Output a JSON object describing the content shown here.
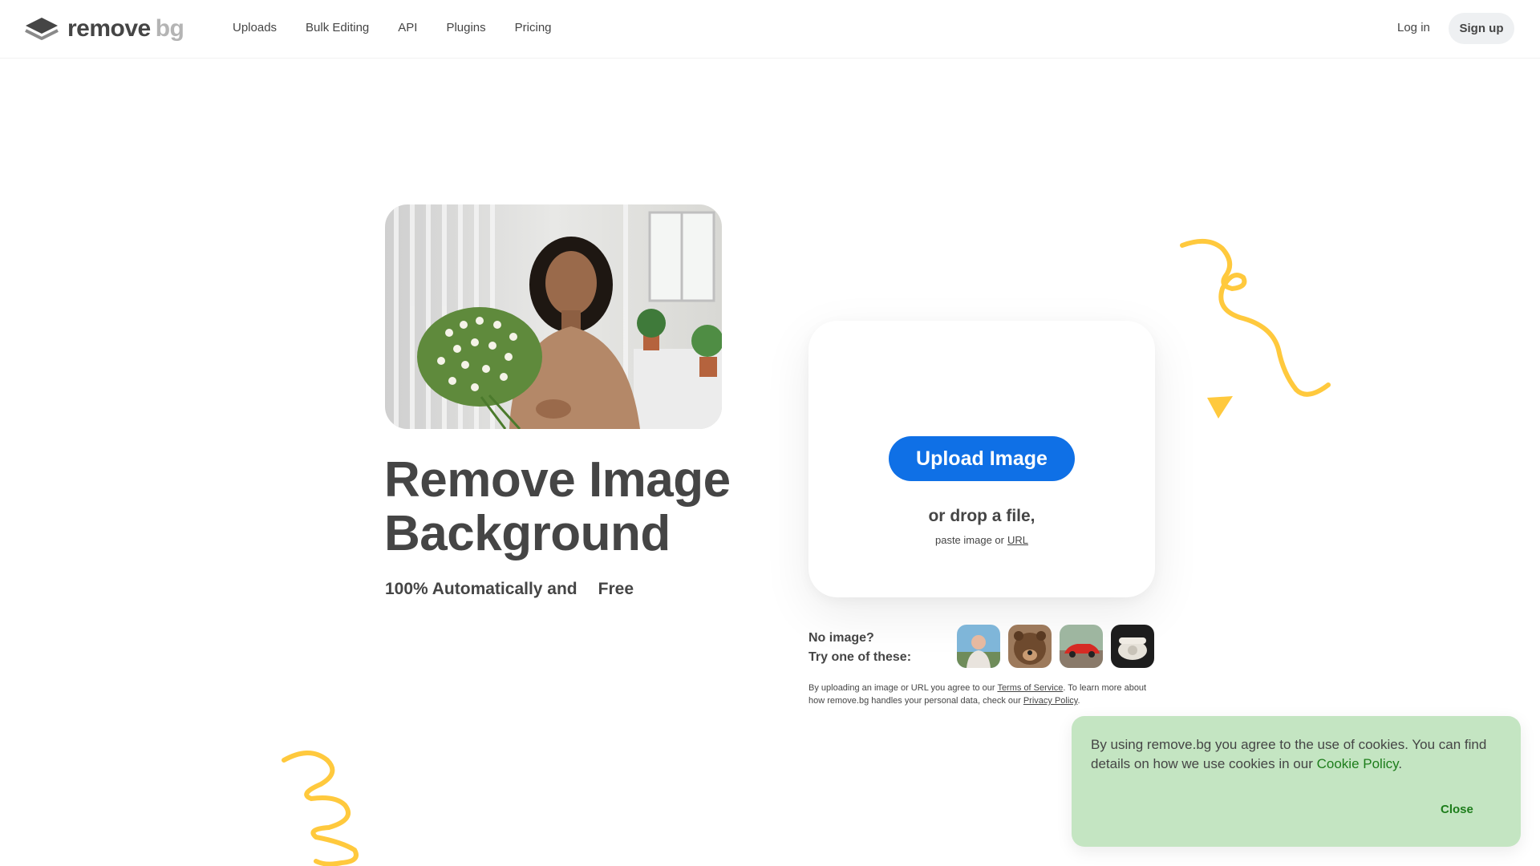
{
  "header": {
    "logo": {
      "word1": "remove",
      "word2": "bg"
    },
    "nav": [
      "Uploads",
      "Bulk Editing",
      "API",
      "Plugins",
      "Pricing"
    ],
    "login": "Log in",
    "signup": "Sign up"
  },
  "hero": {
    "title_line1": "Remove Image",
    "title_line2": "Background",
    "subtitle": "100% Automatically and",
    "free": "Free"
  },
  "upload": {
    "button": "Upload Image",
    "drop": "or drop a file,",
    "paste": "paste image or",
    "url": "URL"
  },
  "samples": {
    "line1": "No image?",
    "line2": "Try one of these:",
    "items": [
      "person-thumbnail",
      "bear-thumbnail",
      "car-thumbnail",
      "phone-thumbnail"
    ]
  },
  "legal": {
    "part1": "By uploading an image or URL you agree to our",
    "terms": "Terms of Service",
    "part2": ". To learn more about how remove.bg handles your personal data, check our",
    "privacy": "Privacy Policy",
    "part3": "."
  },
  "cookie": {
    "text": "By using remove.bg you agree to the use of cookies. You can find details on how we use cookies in our",
    "link": "Cookie Policy",
    "after": ".",
    "close": "Close"
  },
  "colors": {
    "primary": "#0f70e6",
    "accent_yellow": "#ffc93d",
    "cookie_bg": "#c4e5c2",
    "cookie_link": "#1d7d1b",
    "text": "#454545"
  }
}
